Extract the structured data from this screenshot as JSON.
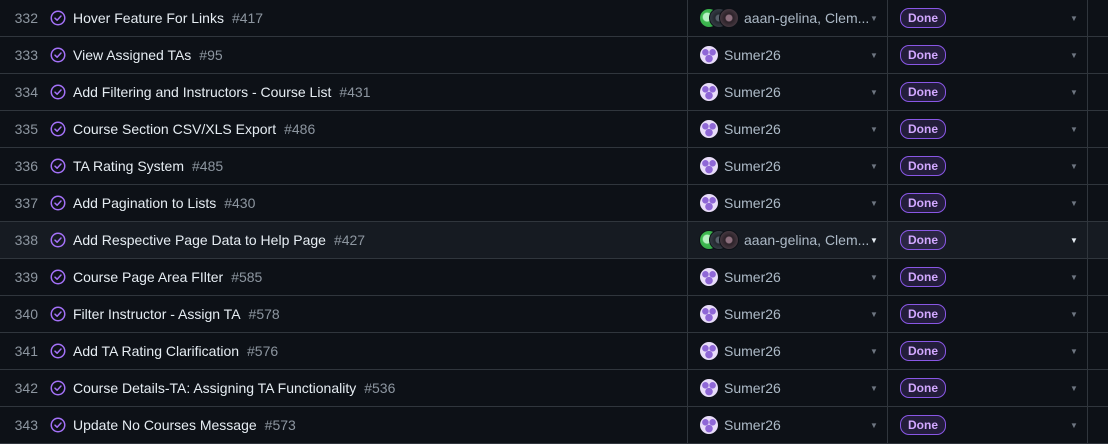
{
  "colors": {
    "background": "#0d1117",
    "done_badge": "#8957e5",
    "status_icon": "#a371f7"
  },
  "icons": {
    "status": "check-circle-icon",
    "dropdown": "caret-down-icon"
  },
  "rows": [
    {
      "num": "332",
      "title": "Hover Feature For Links",
      "issue": "#417",
      "assignee": "aaan-gelina, Clem...",
      "avatar": "group",
      "status": "Done"
    },
    {
      "num": "333",
      "title": "View Assigned TAs",
      "issue": "#95",
      "assignee": "Sumer26",
      "avatar": "single",
      "status": "Done"
    },
    {
      "num": "334",
      "title": "Add Filtering and Instructors - Course List",
      "issue": "#431",
      "assignee": "Sumer26",
      "avatar": "single",
      "status": "Done"
    },
    {
      "num": "335",
      "title": "Course Section CSV/XLS Export",
      "issue": "#486",
      "assignee": "Sumer26",
      "avatar": "single",
      "status": "Done"
    },
    {
      "num": "336",
      "title": "TA Rating System",
      "issue": "#485",
      "assignee": "Sumer26",
      "avatar": "single",
      "status": "Done"
    },
    {
      "num": "337",
      "title": "Add Pagination to Lists",
      "issue": "#430",
      "assignee": "Sumer26",
      "avatar": "single",
      "status": "Done"
    },
    {
      "num": "338",
      "title": "Add Respective Page Data to Help Page",
      "issue": "#427",
      "assignee": "aaan-gelina, Clem...",
      "avatar": "group",
      "status": "Done",
      "hover": true
    },
    {
      "num": "339",
      "title": "Course Page Area FIlter",
      "issue": "#585",
      "assignee": "Sumer26",
      "avatar": "single",
      "status": "Done"
    },
    {
      "num": "340",
      "title": "Filter Instructor - Assign TA",
      "issue": "#578",
      "assignee": "Sumer26",
      "avatar": "single",
      "status": "Done"
    },
    {
      "num": "341",
      "title": "Add TA Rating Clarification",
      "issue": "#576",
      "assignee": "Sumer26",
      "avatar": "single",
      "status": "Done"
    },
    {
      "num": "342",
      "title": "Course Details-TA: Assigning TA Functionality",
      "issue": "#536",
      "assignee": "Sumer26",
      "avatar": "single",
      "status": "Done"
    },
    {
      "num": "343",
      "title": "Update No Courses Message",
      "issue": "#573",
      "assignee": "Sumer26",
      "avatar": "single",
      "status": "Done"
    }
  ]
}
